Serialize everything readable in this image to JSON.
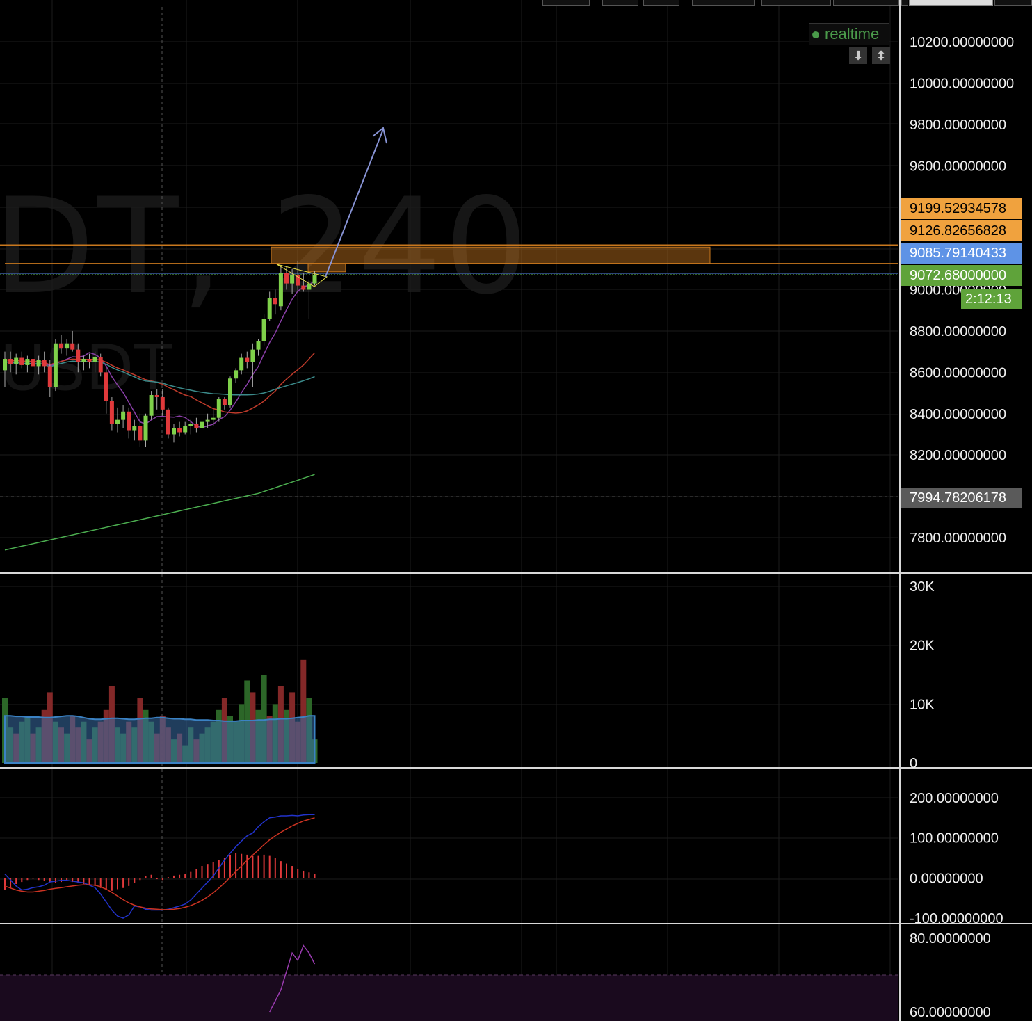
{
  "chart": {
    "watermark": "DT, 240",
    "watermark_sub": "USDT",
    "realtime_label": "realtime",
    "scroll_buttons": [
      "⬇",
      "⬍"
    ],
    "top_tabs_count": 9
  },
  "price_tags": [
    {
      "value": "9199.52934578",
      "color": "#f0a23e",
      "text_color": "#000000"
    },
    {
      "value": "9126.82656828",
      "color": "#f0a23e",
      "text_color": "#000000"
    },
    {
      "value": "9085.79140433",
      "color": "#5e93e6",
      "text_color": "#ffffff"
    },
    {
      "value": "9072.68000000",
      "color": "#5fa33a",
      "text_color": "#ffffff"
    },
    {
      "value": "7994.78206178",
      "color": "#5a5a5a",
      "text_color": "#ffffff"
    }
  ],
  "countdown": "2:12:13",
  "colors": {
    "up": "#7fd14a",
    "down": "#e0393b",
    "grid": "#1c1c1c",
    "zone": "#c9781e",
    "ma_fast": "#8a3fa8",
    "ma_mid": "#c03b2b",
    "ma_slow": "#3b8a8a",
    "ma_long": "#4caf50",
    "arrow": "#8894d6",
    "vol_ma": "#2f7fbf",
    "macd": "#2233cc",
    "signal": "#cc3322",
    "rsi": "#9a3bb0"
  },
  "chart_data": [
    {
      "type": "candlestick",
      "pair": "USDT",
      "interval": "240",
      "ylim": [
        7700,
        10300
      ],
      "yticks": [
        "7800.00000000",
        "8200.00000000",
        "8400.00000000",
        "8600.00000000",
        "8800.00000000",
        "9000.00000000",
        "9600.00000000",
        "9800.00000000",
        "10000.00000000",
        "10200.00000000"
      ],
      "current_price": 9072.68,
      "levels": [
        9199.52934578,
        9126.82656828,
        9085.79140433,
        9072.68,
        7994.78206178
      ],
      "candles": [
        {
          "o": 8610,
          "h": 8700,
          "l": 8530,
          "c": 8665
        },
        {
          "o": 8665,
          "h": 8700,
          "l": 8600,
          "c": 8640
        },
        {
          "o": 8640,
          "h": 8690,
          "l": 8590,
          "c": 8670
        },
        {
          "o": 8670,
          "h": 8700,
          "l": 8620,
          "c": 8635
        },
        {
          "o": 8635,
          "h": 8680,
          "l": 8600,
          "c": 8665
        },
        {
          "o": 8665,
          "h": 8690,
          "l": 8620,
          "c": 8630
        },
        {
          "o": 8630,
          "h": 8680,
          "l": 8590,
          "c": 8660
        },
        {
          "o": 8660,
          "h": 8700,
          "l": 8600,
          "c": 8630
        },
        {
          "o": 8630,
          "h": 8660,
          "l": 8480,
          "c": 8530
        },
        {
          "o": 8530,
          "h": 8760,
          "l": 8510,
          "c": 8740
        },
        {
          "o": 8740,
          "h": 8780,
          "l": 8690,
          "c": 8715
        },
        {
          "o": 8715,
          "h": 8760,
          "l": 8680,
          "c": 8740
        },
        {
          "o": 8740,
          "h": 8800,
          "l": 8700,
          "c": 8710
        },
        {
          "o": 8710,
          "h": 8740,
          "l": 8600,
          "c": 8650
        },
        {
          "o": 8650,
          "h": 8680,
          "l": 8610,
          "c": 8665
        },
        {
          "o": 8665,
          "h": 8690,
          "l": 8620,
          "c": 8650
        },
        {
          "o": 8650,
          "h": 8700,
          "l": 8600,
          "c": 8675
        },
        {
          "o": 8675,
          "h": 8690,
          "l": 8580,
          "c": 8600
        },
        {
          "o": 8600,
          "h": 8620,
          "l": 8400,
          "c": 8460
        },
        {
          "o": 8460,
          "h": 8480,
          "l": 8320,
          "c": 8350
        },
        {
          "o": 8350,
          "h": 8430,
          "l": 8310,
          "c": 8370
        },
        {
          "o": 8370,
          "h": 8440,
          "l": 8330,
          "c": 8410
        },
        {
          "o": 8410,
          "h": 8430,
          "l": 8280,
          "c": 8320
        },
        {
          "o": 8320,
          "h": 8370,
          "l": 8270,
          "c": 8340
        },
        {
          "o": 8340,
          "h": 8400,
          "l": 8240,
          "c": 8270
        },
        {
          "o": 8270,
          "h": 8400,
          "l": 8240,
          "c": 8390
        },
        {
          "o": 8390,
          "h": 8510,
          "l": 8370,
          "c": 8490
        },
        {
          "o": 8490,
          "h": 8520,
          "l": 8420,
          "c": 8480
        },
        {
          "o": 8480,
          "h": 8520,
          "l": 8390,
          "c": 8420
        },
        {
          "o": 8420,
          "h": 8430,
          "l": 8280,
          "c": 8300
        },
        {
          "o": 8300,
          "h": 8350,
          "l": 8260,
          "c": 8330
        },
        {
          "o": 8330,
          "h": 8360,
          "l": 8290,
          "c": 8310
        },
        {
          "o": 8310,
          "h": 8360,
          "l": 8300,
          "c": 8340
        },
        {
          "o": 8340,
          "h": 8370,
          "l": 8300,
          "c": 8350
        },
        {
          "o": 8350,
          "h": 8380,
          "l": 8310,
          "c": 8330
        },
        {
          "o": 8330,
          "h": 8370,
          "l": 8290,
          "c": 8360
        },
        {
          "o": 8360,
          "h": 8400,
          "l": 8330,
          "c": 8370
        },
        {
          "o": 8370,
          "h": 8420,
          "l": 8340,
          "c": 8380
        },
        {
          "o": 8380,
          "h": 8480,
          "l": 8360,
          "c": 8470
        },
        {
          "o": 8470,
          "h": 8480,
          "l": 8420,
          "c": 8440
        },
        {
          "o": 8440,
          "h": 8580,
          "l": 8430,
          "c": 8570
        },
        {
          "o": 8570,
          "h": 8620,
          "l": 8550,
          "c": 8610
        },
        {
          "o": 8610,
          "h": 8690,
          "l": 8590,
          "c": 8670
        },
        {
          "o": 8670,
          "h": 8700,
          "l": 8620,
          "c": 8650
        },
        {
          "o": 8650,
          "h": 8740,
          "l": 8530,
          "c": 8710
        },
        {
          "o": 8710,
          "h": 8760,
          "l": 8680,
          "c": 8750
        },
        {
          "o": 8750,
          "h": 8880,
          "l": 8730,
          "c": 8860
        },
        {
          "o": 8860,
          "h": 8990,
          "l": 8850,
          "c": 8960
        },
        {
          "o": 8960,
          "h": 9000,
          "l": 8880,
          "c": 8930
        },
        {
          "o": 8920,
          "h": 9120,
          "l": 8900,
          "c": 9080
        },
        {
          "o": 9080,
          "h": 9110,
          "l": 9000,
          "c": 9030
        },
        {
          "o": 9030,
          "h": 9100,
          "l": 8980,
          "c": 9070
        },
        {
          "o": 9070,
          "h": 9140,
          "l": 8990,
          "c": 9020
        },
        {
          "o": 9020,
          "h": 9080,
          "l": 8990,
          "c": 9000
        },
        {
          "o": 9000,
          "h": 9050,
          "l": 8860,
          "c": 9030
        },
        {
          "o": 9030,
          "h": 9090,
          "l": 9020,
          "c": 9072.68
        }
      ]
    },
    {
      "type": "bar",
      "name": "volume",
      "ylim": [
        0,
        32000
      ],
      "yticks": [
        "0",
        "10K",
        "20K",
        "30K"
      ],
      "values": [
        11000,
        6000,
        5000,
        7000,
        8000,
        5000,
        6000,
        9000,
        12000,
        7000,
        6000,
        5000,
        8000,
        6000,
        7000,
        4000,
        6000,
        7000,
        9000,
        13000,
        6000,
        5000,
        7000,
        6000,
        11000,
        9000,
        7000,
        5000,
        8000,
        6000,
        4000,
        5000,
        3000,
        6000,
        4000,
        5000,
        6000,
        7000,
        9000,
        11000,
        8000,
        7000,
        10000,
        14000,
        12000,
        9000,
        15000,
        8000,
        10000,
        13000,
        9000,
        12000,
        7000,
        17500,
        11000,
        4000
      ],
      "up": [
        true,
        true,
        false,
        true,
        true,
        false,
        true,
        false,
        false,
        true,
        false,
        true,
        false,
        false,
        true,
        false,
        true,
        false,
        false,
        false,
        true,
        true,
        false,
        true,
        false,
        true,
        true,
        false,
        false,
        false,
        true,
        false,
        true,
        true,
        false,
        true,
        true,
        true,
        true,
        false,
        true,
        true,
        true,
        true,
        false,
        true,
        true,
        false,
        true,
        false,
        true,
        false,
        false,
        false,
        true,
        true
      ],
      "ma": [
        8000,
        8000,
        7900,
        7900,
        7800,
        7800,
        7800,
        7700,
        7700,
        7800,
        7900,
        8000,
        8000,
        7900,
        7700,
        7500,
        7400,
        7400,
        7500,
        7600,
        7600,
        7500,
        7400,
        7400,
        7500,
        7600,
        7600,
        7700,
        7700,
        7600,
        7500,
        7500,
        7400,
        7400,
        7300,
        7300,
        7300,
        7200,
        7200,
        7100,
        7100,
        7100,
        7200,
        7200,
        7200,
        7300,
        7300,
        7400,
        7400,
        7500,
        7500,
        7600,
        7700,
        7800,
        8000,
        8000
      ]
    },
    {
      "type": "line",
      "name": "MACD",
      "ylim": [
        -110,
        240
      ],
      "yticks": [
        "-100.00000000",
        "0.00000000",
        "100.00000000",
        "200.00000000"
      ],
      "macd": [
        10,
        -5,
        -20,
        -30,
        -28,
        -24,
        -22,
        -18,
        -10,
        -8,
        -6,
        -6,
        -8,
        -10,
        -12,
        -18,
        -24,
        -40,
        -60,
        -80,
        -95,
        -100,
        -92,
        -70,
        -72,
        -78,
        -80,
        -80,
        -80,
        -78,
        -74,
        -70,
        -65,
        -55,
        -40,
        -25,
        -10,
        5,
        25,
        45,
        62,
        78,
        92,
        105,
        112,
        128,
        140,
        150,
        152,
        155,
        155,
        156,
        155,
        157,
        158,
        158
      ],
      "signal": [
        -20,
        -25,
        -30,
        -33,
        -35,
        -35,
        -33,
        -31,
        -28,
        -26,
        -24,
        -22,
        -20,
        -18,
        -17,
        -17,
        -18,
        -22,
        -28,
        -36,
        -45,
        -54,
        -62,
        -68,
        -72,
        -75,
        -77,
        -78,
        -79,
        -79,
        -78,
        -76,
        -73,
        -69,
        -63,
        -56,
        -47,
        -37,
        -25,
        -12,
        2,
        16,
        30,
        44,
        57,
        70,
        83,
        95,
        105,
        114,
        122,
        130,
        136,
        142,
        146,
        150
      ],
      "hist": [
        -30,
        -25,
        -15,
        -10,
        -5,
        0,
        -5,
        -8,
        -10,
        -12,
        -10,
        -8,
        -10,
        -12,
        -15,
        -18,
        -20,
        -25,
        -30,
        -32,
        -28,
        -25,
        -20,
        -12,
        -5,
        5,
        8,
        -3,
        -5,
        2,
        6,
        8,
        10,
        15,
        22,
        30,
        35,
        40,
        45,
        50,
        58,
        62,
        60,
        58,
        55,
        55,
        58,
        55,
        50,
        42,
        36,
        30,
        22,
        18,
        14,
        10
      ]
    },
    {
      "type": "line",
      "name": "RSI",
      "ylim": [
        58,
        82
      ],
      "yticks": [
        "60.00000000",
        "80.00000000"
      ],
      "band_upper": 70,
      "values": [
        null,
        null,
        null,
        null,
        null,
        null,
        null,
        null,
        null,
        null,
        null,
        null,
        null,
        null,
        null,
        null,
        null,
        null,
        null,
        null,
        null,
        null,
        null,
        null,
        null,
        null,
        null,
        null,
        null,
        null,
        null,
        null,
        null,
        null,
        null,
        null,
        null,
        null,
        null,
        null,
        null,
        null,
        null,
        null,
        null,
        null,
        null,
        60,
        63,
        66,
        71,
        76,
        74,
        78,
        76,
        73
      ]
    }
  ]
}
